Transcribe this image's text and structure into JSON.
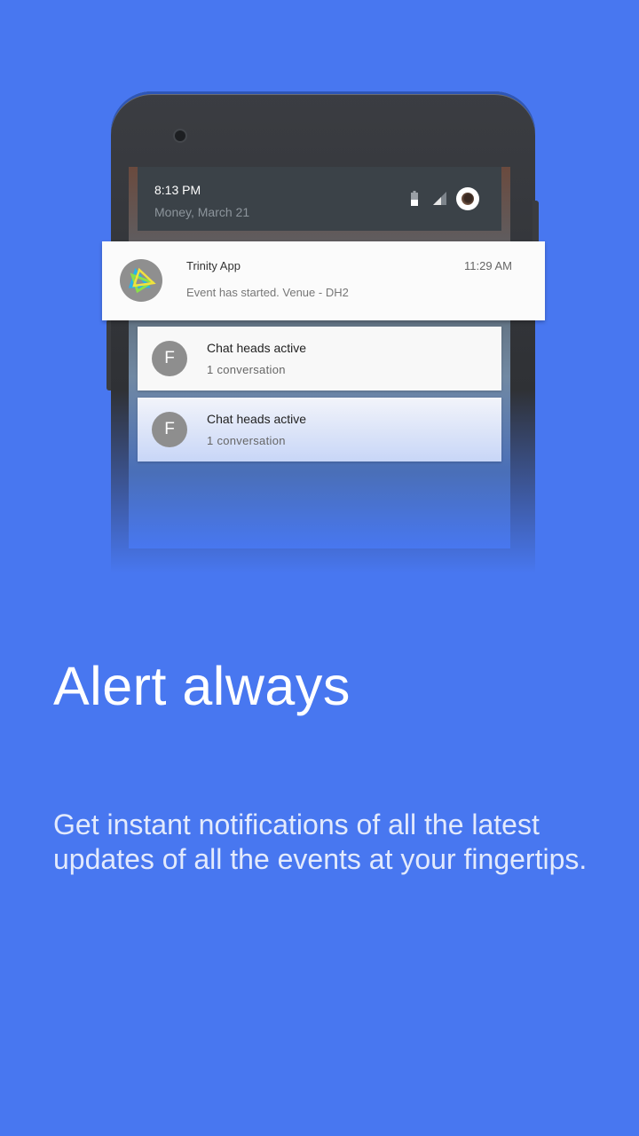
{
  "colors": {
    "background": "#4877f0",
    "statusbar": "#3b4248",
    "card": "#fbfbfb"
  },
  "statusbar": {
    "time": "8:13 PM",
    "date": "Money, March 21",
    "icons": [
      "battery-icon",
      "signal-icon",
      "avatar"
    ]
  },
  "notifications": {
    "main": {
      "app_name": "Trinity App",
      "time": "11:29 AM",
      "text": "Event has started. Venue - DH2",
      "icon": "trinity-logo-icon"
    },
    "chats": [
      {
        "avatar_letter": "F",
        "title": "Chat heads active",
        "subtitle": "1 conversation"
      },
      {
        "avatar_letter": "F",
        "title": "Chat heads active",
        "subtitle": "1 conversation"
      }
    ]
  },
  "onboarding": {
    "headline": "Alert always",
    "body": "Get instant notifications of all the latest updates of all the events at your fingertips."
  }
}
